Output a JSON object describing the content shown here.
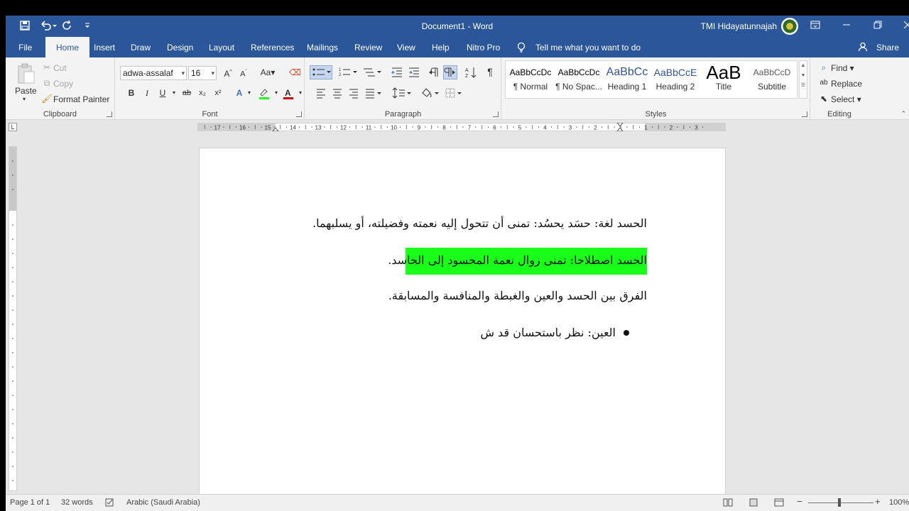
{
  "titlebar": {
    "title": "Document1 - Word",
    "user": "TMI Hidayatunnajah"
  },
  "tabs": [
    "File",
    "Home",
    "Insert",
    "Draw",
    "Design",
    "Layout",
    "References",
    "Mailings",
    "Review",
    "View",
    "Help",
    "Nitro Pro"
  ],
  "tell_me": "Tell me what you want to do",
  "share": "Share",
  "clipboard": {
    "paste": "Paste",
    "cut": "Cut",
    "copy": "Copy",
    "format_painter": "Format Painter",
    "label": "Clipboard"
  },
  "font": {
    "family": "adwa-assalaf",
    "size": "16",
    "label": "Font",
    "bold": "B",
    "italic": "I",
    "underline": "U",
    "strike": "ab",
    "subscript": "x₂",
    "superscript": "x²"
  },
  "paragraph": {
    "label": "Paragraph"
  },
  "styles": {
    "label": "Styles",
    "items": [
      {
        "preview": "AaBbCcDc",
        "name": "¶ Normal"
      },
      {
        "preview": "AaBbCcDc",
        "name": "¶ No Spac..."
      },
      {
        "preview": "AaBbCc",
        "name": "Heading 1"
      },
      {
        "preview": "AaBbCcE",
        "name": "Heading 2"
      },
      {
        "preview": "AaB",
        "name": "Title"
      },
      {
        "preview": "AaBbCcD",
        "name": "Subtitle"
      }
    ]
  },
  "editing": {
    "label": "Editing",
    "find": "Find",
    "replace": "Replace",
    "select": "Select"
  },
  "document": {
    "p1": "الحسد لغة: حسَد يحسُد: تمنى أن تتحول إليه نعمته وفضيلته، أو يسلبهما.",
    "p2": "الحسد اصطلاحا: تمنى زوال نعمة المحسود إلى الحاسد.",
    "p3": "الفرق بين الحسد والعين والغبطة والمنافسة والمسابقة.",
    "bullet": "العين: نظر باستحسان قد ش"
  },
  "highlight_color": "#19ff19",
  "status": {
    "page": "Page 1 of 1",
    "words": "32 words",
    "language": "Arabic (Saudi Arabia)",
    "zoom": "100%"
  },
  "ruler_numbers": [
    "17",
    "16",
    "15",
    "14",
    "13",
    "12",
    "11",
    "10",
    "9",
    "8",
    "7",
    "6",
    "5",
    "4",
    "3",
    "2",
    "1",
    "1",
    "2",
    "3"
  ]
}
